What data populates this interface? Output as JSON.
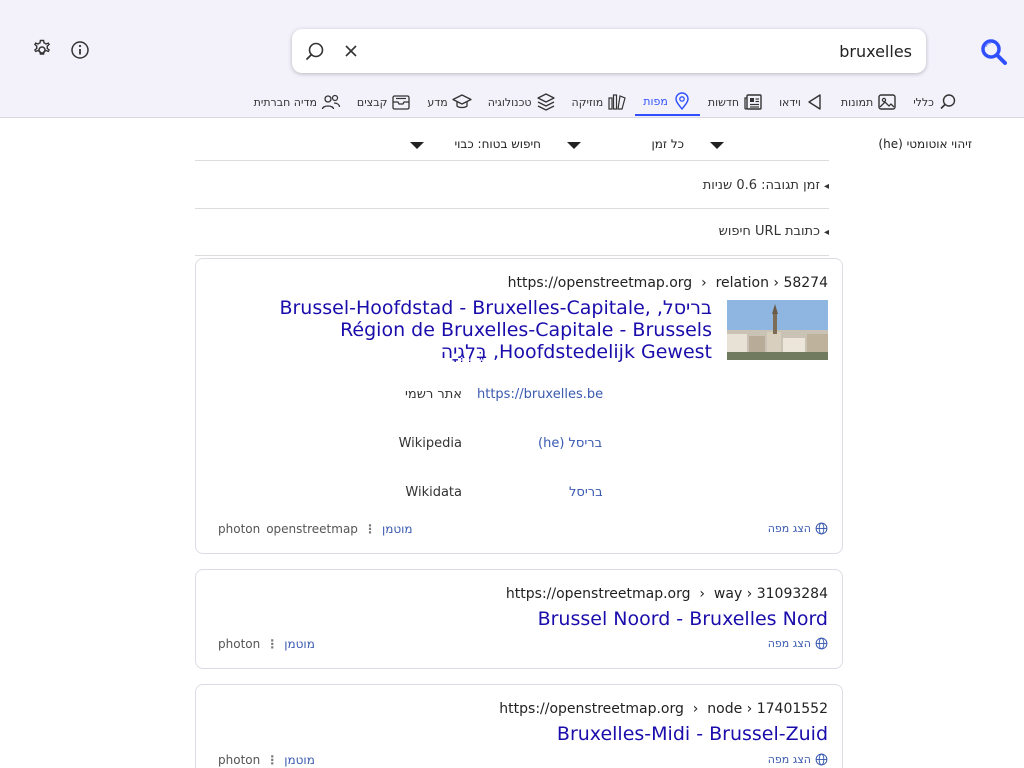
{
  "search": {
    "query": "bruxelles"
  },
  "tabs": [
    {
      "label": "כללי",
      "icon": "search-icon",
      "active": false
    },
    {
      "label": "תמונות",
      "icon": "image-icon",
      "active": false
    },
    {
      "label": "וידאו",
      "icon": "play-icon",
      "active": false
    },
    {
      "label": "חדשות",
      "icon": "newspaper-icon",
      "active": false
    },
    {
      "label": "מפות",
      "icon": "map-pin-icon",
      "active": true
    },
    {
      "label": "מוזיקה",
      "icon": "music-icon",
      "active": false
    },
    {
      "label": "טכנולוגיה",
      "icon": "layers-icon",
      "active": false
    },
    {
      "label": "מדע",
      "icon": "graduation-cap-icon",
      "active": false
    },
    {
      "label": "קבצים",
      "icon": "archive-icon",
      "active": false
    },
    {
      "label": "מדיה חברתית",
      "icon": "people-icon",
      "active": false
    }
  ],
  "filters": {
    "language": "זיהוי אוטומטי (he)",
    "time": "כל זמן",
    "safe": "חיפוש בטוח: כבוי"
  },
  "response_time": "זמן תגובה: 0.6 שניות",
  "search_url": "כתובת URL חיפוש",
  "results": [
    {
      "url_host": "https://openstreetmap.org",
      "url_path": "relation › 58274",
      "title": "בריסל, Brussel-Hoofdstad - Bruxelles-Capitale, Région de Bruxelles-Capitale - Brussels Hoofdstedelijk Gewest, בֶּלְגְיָה",
      "info": [
        {
          "label": "אתר רשמי",
          "value": "https://bruxelles.be"
        },
        {
          "label": "Wikipedia",
          "value": "בריסל (he)"
        },
        {
          "label": "Wikidata",
          "value": "בריסל"
        }
      ],
      "show_map": "הצג מפה",
      "cached": "מוטמן",
      "engines": [
        "openstreetmap",
        "photon"
      ]
    },
    {
      "url_host": "https://openstreetmap.org",
      "url_path": "way › 31093284",
      "title": "Brussel Noord - Bruxelles Nord",
      "show_map": "הצג מפה",
      "cached": "מוטמן",
      "engines": [
        "photon"
      ]
    },
    {
      "url_host": "https://openstreetmap.org",
      "url_path": "node › 17401552",
      "title": "Bruxelles-Midi - Brussel-Zuid",
      "show_map": "הצג מפה",
      "cached": "מוטמן",
      "engines": [
        "photon"
      ]
    }
  ],
  "colors": {
    "accent": "#3050ff",
    "link": "#1a0dab",
    "header_bg": "#f3f2fb"
  }
}
